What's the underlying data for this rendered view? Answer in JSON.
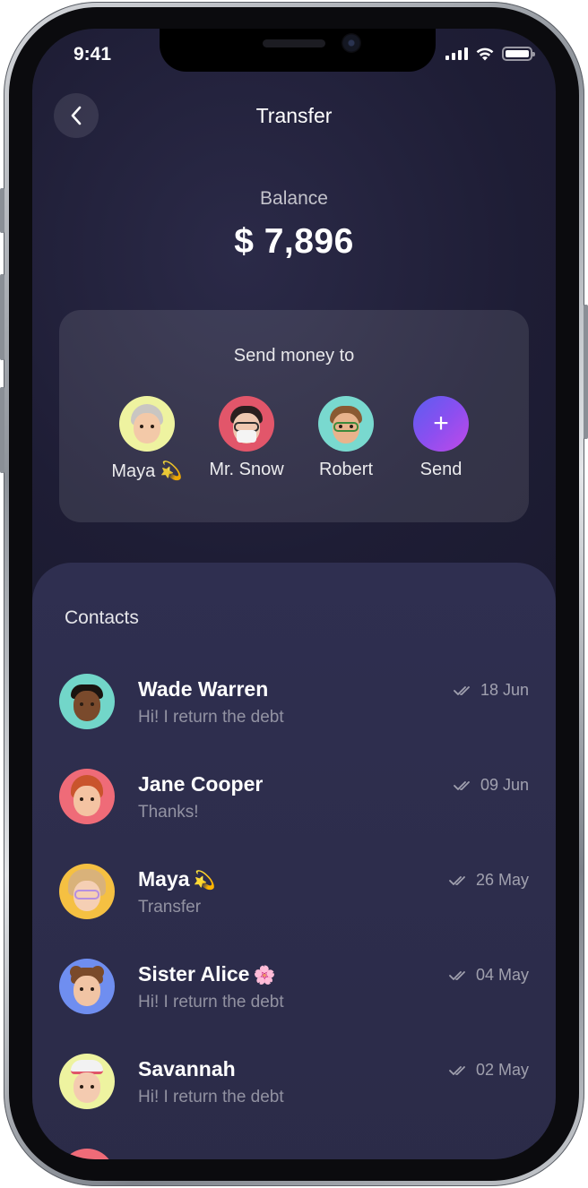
{
  "status_bar": {
    "time": "9:41"
  },
  "header": {
    "title": "Transfer"
  },
  "balance": {
    "label": "Balance",
    "value": "$ 7,896"
  },
  "send_card": {
    "title": "Send money to",
    "recipients": [
      {
        "name": "Maya",
        "emoji": "💫",
        "avatar_bg": "#eef3a0"
      },
      {
        "name": "Mr. Snow",
        "emoji": "",
        "avatar_bg": "#e2566a"
      },
      {
        "name": "Robert",
        "emoji": "",
        "avatar_bg": "#79d9cf"
      }
    ],
    "send_label": "Send",
    "send_icon": "plus-icon"
  },
  "contacts": {
    "title": "Contacts",
    "items": [
      {
        "name": "Wade Warren",
        "emoji": "",
        "message": "Hi! I return the debt",
        "date": "18 Jun",
        "avatar_bg": "#72d6c9"
      },
      {
        "name": "Jane Cooper",
        "emoji": "",
        "message": "Thanks!",
        "date": "09 Jun",
        "avatar_bg": "#ef6b78"
      },
      {
        "name": "Maya",
        "emoji": "💫",
        "message": "Transfer",
        "date": "26 May",
        "avatar_bg": "#f5c042"
      },
      {
        "name": "Sister Alice",
        "emoji": "🌸",
        "message": "Hi! I return the debt",
        "date": "04 May",
        "avatar_bg": "#6f8ef0"
      },
      {
        "name": "Savannah",
        "emoji": "",
        "message": "Hi! I return the debt",
        "date": "02 May",
        "avatar_bg": "#eef3a0"
      }
    ],
    "read_icon": "double-check-icon"
  }
}
